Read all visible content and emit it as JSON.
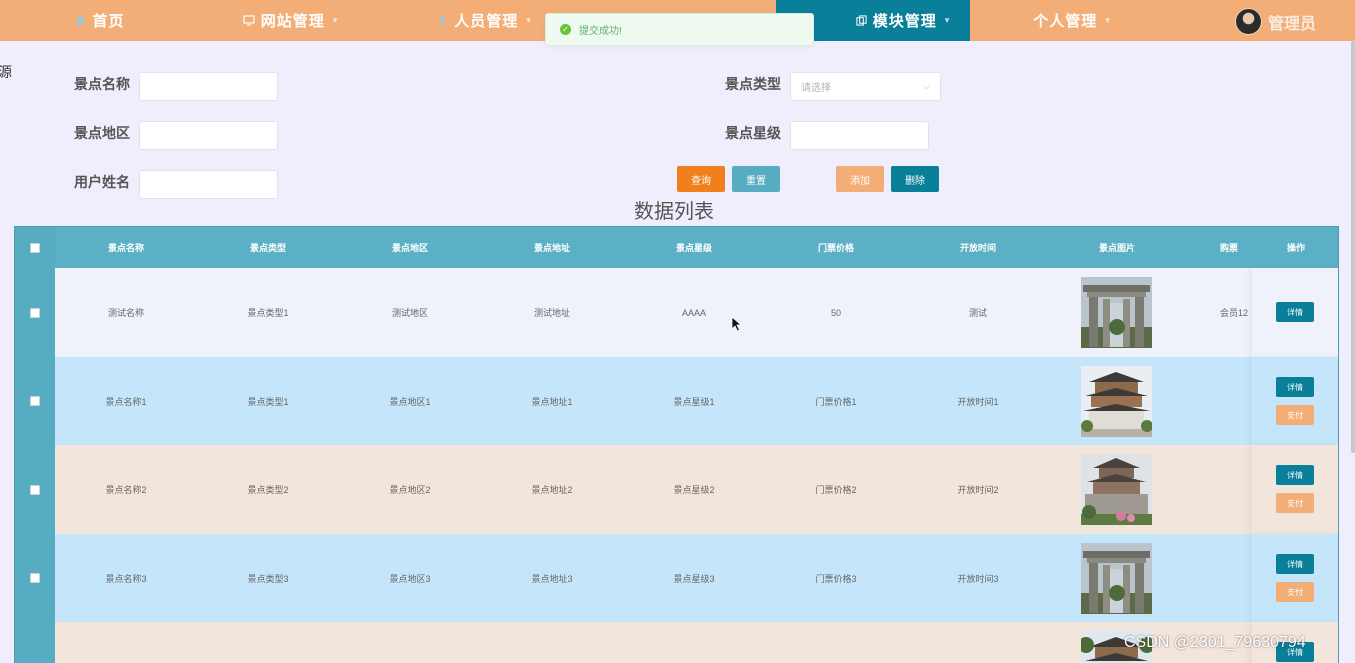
{
  "nav": {
    "items": [
      {
        "label": "首页",
        "icon": "home-icon"
      },
      {
        "label": "网站管理",
        "icon": "monitor-icon"
      },
      {
        "label": "人员管理",
        "icon": "user-icon"
      },
      {
        "label": "模块管理",
        "icon": "copy-icon",
        "active": true
      },
      {
        "label": "个人管理",
        "icon": ""
      }
    ],
    "admin_name": "管理员"
  },
  "toast": {
    "message": "提交成功!"
  },
  "edge_text": "源",
  "search": {
    "name_label": "景点名称",
    "type_label": "景点类型",
    "type_placeholder": "请选择",
    "region_label": "景点地区",
    "star_label": "景点星级",
    "user_label": "用户姓名"
  },
  "buttons": {
    "query": "查询",
    "reset": "重置",
    "add": "添加",
    "delete": "删除"
  },
  "colors": {
    "nav": "#f2ae76",
    "active": "#0a7f9a",
    "query": "#f07f1c",
    "reset": "#56acc1",
    "add": "#f2ae76",
    "delete": "#0a7f9a",
    "header": "#5cb0c6"
  },
  "table": {
    "title": "数据列表",
    "headers": [
      "景点名称",
      "景点类型",
      "景点地区",
      "景点地址",
      "景点星级",
      "门票价格",
      "开放时间",
      "景点图片",
      "购票",
      "操作"
    ],
    "rows": [
      {
        "cells": [
          "测试名称",
          "景点类型1",
          "测试地区",
          "测试地址",
          "AAAA",
          "50",
          "测试",
          "会员12"
        ],
        "pay": false
      },
      {
        "cells": [
          "景点名称1",
          "景点类型1",
          "景点地区1",
          "景点地址1",
          "景点星级1",
          "门票价格1",
          "开放时间1",
          ""
        ],
        "pay": true
      },
      {
        "cells": [
          "景点名称2",
          "景点类型2",
          "景点地区2",
          "景点地址2",
          "景点星级2",
          "门票价格2",
          "开放时间2",
          ""
        ],
        "pay": true
      },
      {
        "cells": [
          "景点名称3",
          "景点类型3",
          "景点地区3",
          "景点地址3",
          "景点星级3",
          "门票价格3",
          "开放时间3",
          ""
        ],
        "pay": true
      }
    ],
    "detail_label": "详情",
    "pay_label": "支付"
  },
  "watermark": "CSDN @2301_79630794"
}
